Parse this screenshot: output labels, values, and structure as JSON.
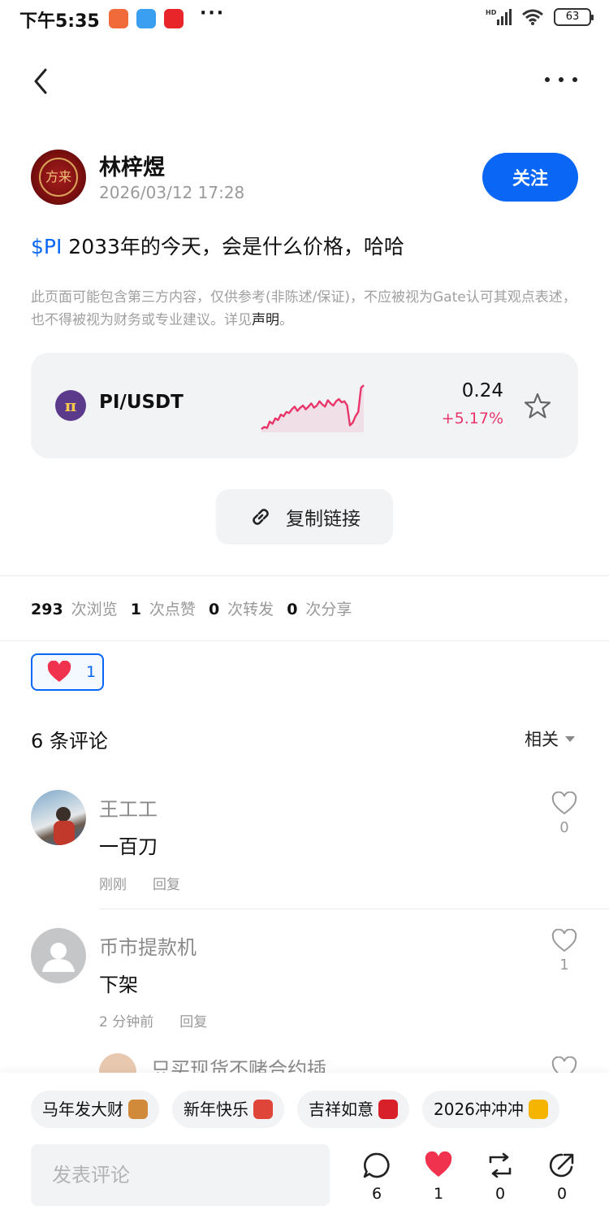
{
  "status_bar": {
    "time": "下午5:35",
    "dots": "···",
    "network": "HD",
    "battery": "63"
  },
  "nav": {
    "back_icon": "chevron-left-icon",
    "more_icon": "more-dots-icon"
  },
  "author": {
    "name": "林梓煜",
    "time": "2026/03/12 17:28",
    "follow_label": "关注",
    "avatar_glyph": "方来"
  },
  "post": {
    "ticker": "$PI",
    "text": " 2033年的今天，会是什么价格，哈哈"
  },
  "disclaimer": {
    "text": "此页面可能包含第三方内容，仅供参考(非陈述/保证)，不应被视为Gate认可其观点表述，也不得被视为财务或专业建议。详见",
    "link": "声明",
    "end": "。"
  },
  "market": {
    "pair": "PI/USDT",
    "coin_icon_glyph": "π",
    "price": "0.24",
    "change": "+5.17%",
    "change_color": "#e8356a",
    "spark_values": [
      0.18,
      0.22,
      0.2,
      0.32,
      0.28,
      0.38,
      0.35,
      0.45,
      0.42,
      0.5,
      0.48,
      0.55,
      0.6,
      0.52,
      0.58,
      0.62,
      0.55,
      0.6,
      0.66,
      0.58,
      0.62,
      0.7,
      0.64,
      0.6,
      0.72,
      0.66,
      0.62,
      0.7,
      0.74,
      0.68,
      0.7,
      0.62,
      0.25,
      0.3,
      0.42,
      0.5,
      0.95,
      1.0
    ]
  },
  "copy_link": {
    "label": "复制链接"
  },
  "stats": [
    {
      "num": "293",
      "label": "次浏览"
    },
    {
      "num": "1",
      "label": "次点赞"
    },
    {
      "num": "0",
      "label": "次转发"
    },
    {
      "num": "0",
      "label": "次分享"
    }
  ],
  "reaction": {
    "count": "1"
  },
  "comments_header": {
    "title": "6 条评论",
    "sort": "相关"
  },
  "comments": [
    {
      "name": "王工工",
      "body": "一百刀",
      "time": "刚刚",
      "reply": "回复",
      "likes": "0"
    },
    {
      "name": "币市提款机",
      "body": "下架",
      "time": "2 分钟前",
      "reply": "回复",
      "likes": "1"
    },
    {
      "name": "只买现货不赌合约插",
      "body": "",
      "time": "",
      "reply": "",
      "likes": ""
    }
  ],
  "quick_replies": [
    {
      "text": "马年发大财",
      "emoji_color": "#d08a3a"
    },
    {
      "text": "新年快乐",
      "emoji_color": "#e0453a"
    },
    {
      "text": "吉祥如意",
      "emoji_color": "#d8202a"
    },
    {
      "text": "2026冲冲冲",
      "emoji_color": "#f4b400"
    }
  ],
  "bottom": {
    "input_placeholder": "发表评论",
    "comment_count": "6",
    "like_count": "1",
    "repost_count": "0",
    "share_count": "0"
  },
  "colors": {
    "accent": "#0a66f5",
    "like_red": "#f0324f"
  }
}
